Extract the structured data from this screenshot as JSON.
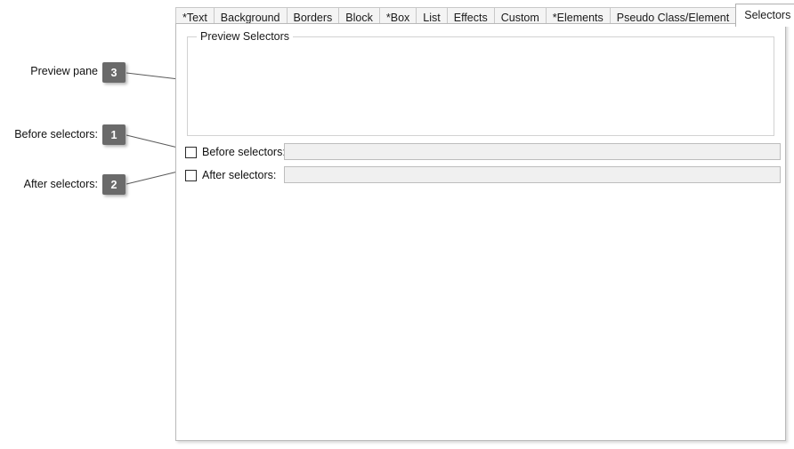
{
  "tabs": [
    {
      "label": "*Text",
      "active": false
    },
    {
      "label": "Background",
      "active": false
    },
    {
      "label": "Borders",
      "active": false
    },
    {
      "label": "Block",
      "active": false
    },
    {
      "label": "*Box",
      "active": false
    },
    {
      "label": "List",
      "active": false
    },
    {
      "label": "Effects",
      "active": false
    },
    {
      "label": "Custom",
      "active": false
    },
    {
      "label": "*Elements",
      "active": false
    },
    {
      "label": "Pseudo Class/Element",
      "active": false
    },
    {
      "label": "Selectors",
      "active": true
    }
  ],
  "groupbox": {
    "title": "Preview Selectors"
  },
  "fields": {
    "before": {
      "label": "Before selectors:",
      "checked": false,
      "value": "",
      "placeholder": ""
    },
    "after": {
      "label": "After selectors:",
      "checked": false,
      "value": "",
      "placeholder": ""
    }
  },
  "annotations": [
    {
      "label": "Preview pane",
      "number": "3"
    },
    {
      "label": "Before selectors:",
      "number": "1"
    },
    {
      "label": "After selectors:",
      "number": "2"
    }
  ],
  "colors": {
    "badge": "#6a6a6a",
    "panel_border": "#b9b9b9",
    "disabled_field": "#f0f0f0",
    "tab_inactive": "#f4f4f4",
    "tab_active": "#ffffff"
  }
}
